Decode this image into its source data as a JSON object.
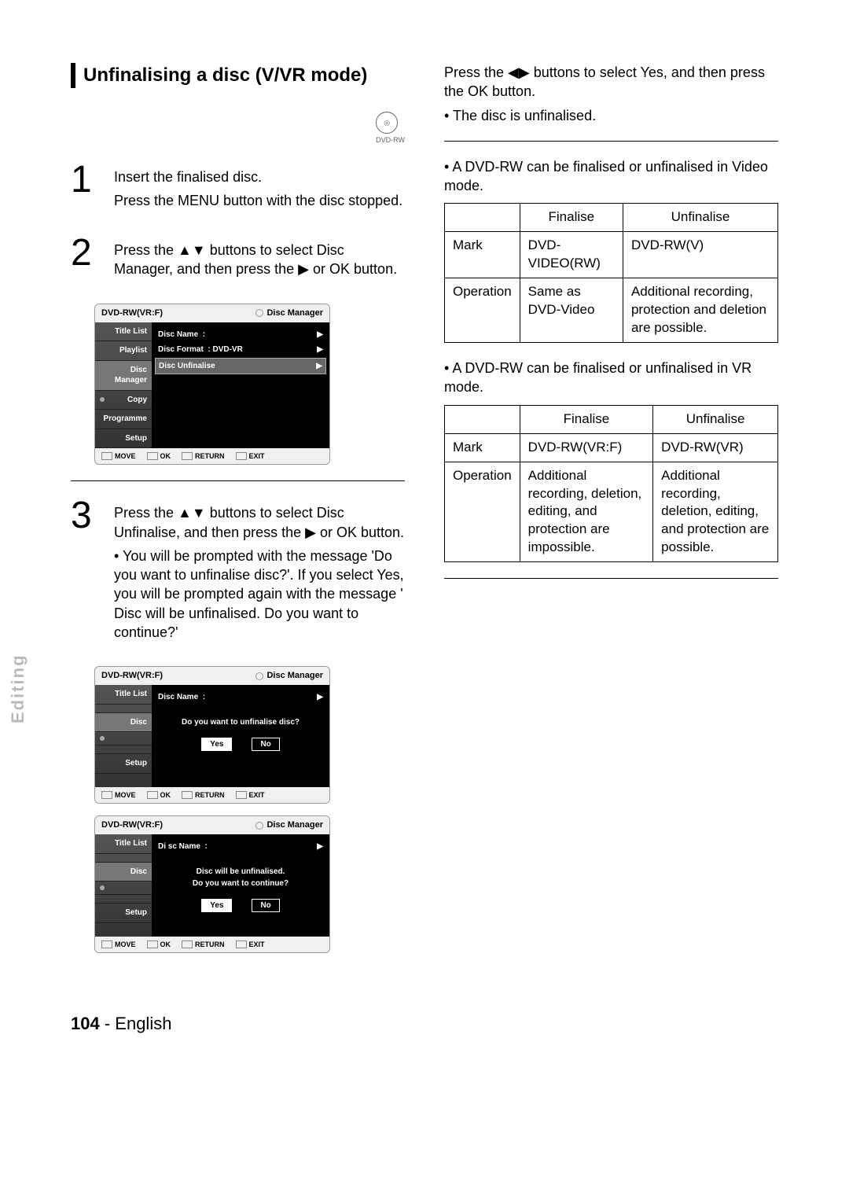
{
  "section_title": "Unfinalising a disc (V/VR mode)",
  "disc_badge": {
    "icon_label": "DVD-RW"
  },
  "step1": {
    "num": "1",
    "line1": "Insert the finalised disc.",
    "line2": "Press the MENU button with the disc stopped."
  },
  "step2": {
    "num": "2",
    "text_a": "Press the ",
    "text_b": " buttons to select Disc Manager, and then press the ",
    "text_c": " or OK  button."
  },
  "step3": {
    "num": "3",
    "text_a": "Press the ",
    "text_b": " buttons to select Disc Unfinalise, and then press the ",
    "text_c": " or OK  button.",
    "bullet": "You will be prompted with the message 'Do you want to unfinalise disc?'. If you select Yes, you will be prompted again with the message ' Disc will be unfinalised. Do you want to continue?'"
  },
  "osd_common": {
    "top_left": "DVD-RW(VR:F)",
    "top_right": "Disc Manager",
    "foot": {
      "move": "MOVE",
      "ok": "OK",
      "return": "RETURN",
      "exit": "EXIT"
    }
  },
  "osd1": {
    "side": [
      "Title List",
      "Playlist",
      "Disc Manager",
      "Copy",
      "Programme",
      "Setup"
    ],
    "rows": [
      {
        "label": "Disc Name",
        "value": ":"
      },
      {
        "label": "Disc Format",
        "value": ": DVD-VR"
      },
      {
        "label": "Disc Unfinalise",
        "value": "",
        "hl": true
      }
    ]
  },
  "osd2": {
    "side": [
      "Title List",
      "",
      "Disc",
      "",
      "",
      "Setup"
    ],
    "row_label": "Disc Name",
    "row_value": ":",
    "msg": "Do you want to unfinalise disc?",
    "yes": "Yes",
    "no": "No"
  },
  "osd3": {
    "side": [
      "Title List",
      "",
      "Disc",
      "",
      "",
      "Setup"
    ],
    "row_label": "Di sc Name",
    "row_value": ":",
    "msg1": "Disc will be unfinalised.",
    "msg2": "Do you want to continue?",
    "yes": "Yes",
    "no": "No"
  },
  "right_intro": {
    "line1_a": "Press the ",
    "line1_b": " buttons to select Yes, and then press the OK button.",
    "bullet": "The disc is unfinalised."
  },
  "right_note1": "A DVD-RW can be finalised or unfinalised in Video mode.",
  "table1": {
    "h1": "",
    "h2": "Finalise",
    "h3": "Unfinalise",
    "r1c1": "Mark",
    "r1c2": "DVD-VIDEO(RW)",
    "r1c3": "DVD-RW(V)",
    "r2c1": "Operation",
    "r2c2": "Same as DVD-Video",
    "r2c3": "Additional recording, protection and deletion are possible."
  },
  "right_note2": "A DVD-RW can be finalised or unfinalised in VR mode.",
  "table2": {
    "h1": "",
    "h2": "Finalise",
    "h3": "Unfinalise",
    "r1c1": "Mark",
    "r1c2": "DVD-RW(VR:F)",
    "r1c3": "DVD-RW(VR)",
    "r2c1": "Operation",
    "r2c2": "Additional recording, deletion, editing, and protection are impossible.",
    "r2c3": "Additional recording, deletion, editing, and protection are possible."
  },
  "arrows": {
    "ud": "▲▼",
    "right": "▶",
    "lr": "◀▶"
  },
  "side_label": "Editing",
  "page_footer": {
    "num": "104",
    "sep": " - ",
    "lang": "English"
  }
}
